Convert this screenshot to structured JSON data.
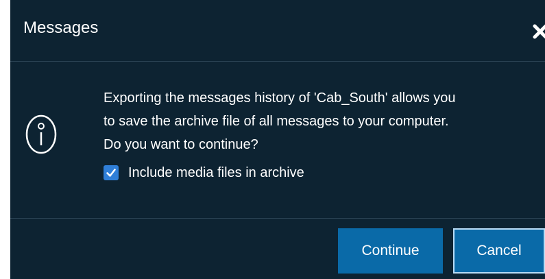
{
  "dialog": {
    "title": "Messages",
    "close_icon": "close-icon",
    "info_icon": "info-icon",
    "message_lines": [
      "Exporting the messages history of 'Cab_South' allows you",
      "to save the archive file of all messages to your computer.",
      "Do you want to continue?"
    ],
    "checkbox": {
      "label": "Include media files in archive",
      "checked": true
    },
    "buttons": {
      "continue_label": "Continue",
      "cancel_label": "Cancel"
    }
  },
  "colors": {
    "dialog_background": "#0d2332",
    "divider": "#2b4354",
    "button_background": "#0a6aa8",
    "checkbox_accent": "#2f7fd8",
    "focus_border": "#b9dcf5",
    "text": "#ffffff"
  }
}
